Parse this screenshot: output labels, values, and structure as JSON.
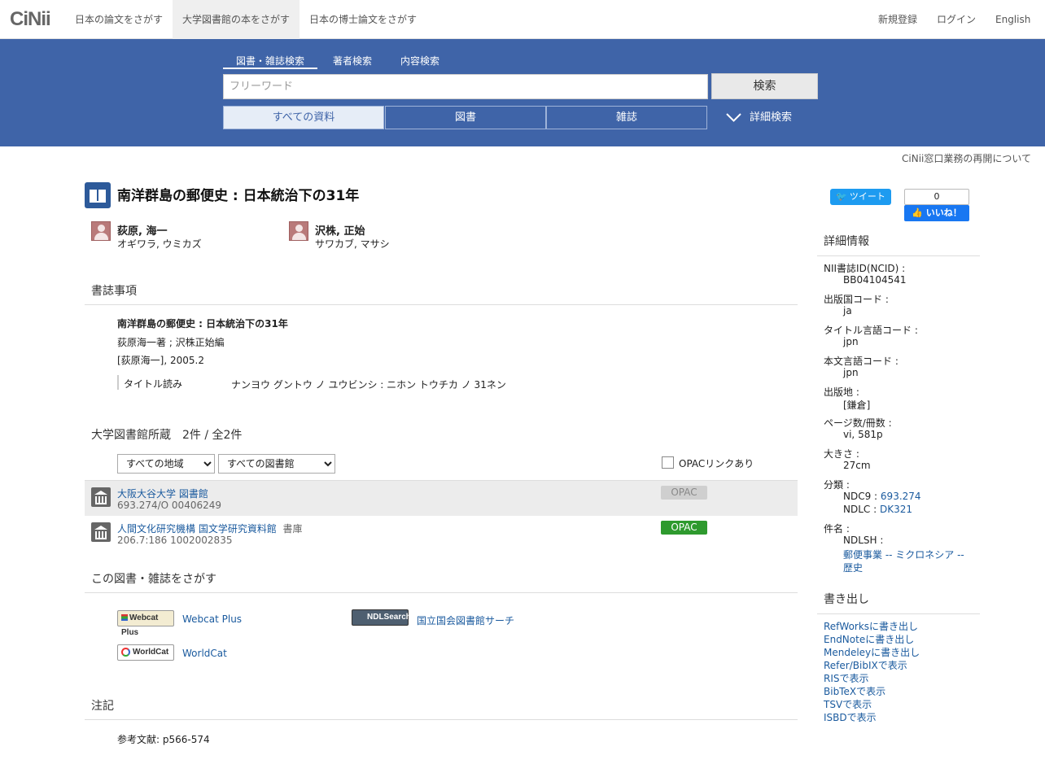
{
  "nav": {
    "logo": "CiNii",
    "tabs": [
      "日本の論文をさがす",
      "大学図書館の本をさがす",
      "日本の博士論文をさがす"
    ],
    "register": "新規登録",
    "login": "ログイン",
    "language": "English"
  },
  "search": {
    "tabs": [
      "図書・雑誌検索",
      "著者検索",
      "内容検索"
    ],
    "placeholder": "フリーワード",
    "button": "検索",
    "scopes": [
      "すべての資料",
      "図書",
      "雑誌"
    ],
    "advanced": "詳細検索"
  },
  "notice": "CiNii窓口業務の再開について",
  "book": {
    "title": "南洋群島の郵便史 : 日本統治下の31年",
    "authors": [
      {
        "name": "荻原, 海一",
        "kana": "オギワラ, ウミカズ"
      },
      {
        "name": "沢株, 正始",
        "kana": "サワカブ, マサシ"
      }
    ]
  },
  "bib": {
    "heading": "書誌事項",
    "title": "南洋群島の郵便史 : 日本統治下の31年",
    "responsibility": "荻原海一著 ; 沢株正始編",
    "publication": "[荻原海一], 2005.2",
    "reading_label": "タイトル読み",
    "reading_value": "ナンヨウ グントウ ノ ユウビンシ : ニホン トウチカ ノ 31ネン"
  },
  "holdings": {
    "heading": "大学図書館所蔵　2件 / 全2件",
    "region_select": "すべての地域",
    "library_select": "すべての図書館",
    "opac_checkbox": "OPACリンクあり",
    "libraries": [
      {
        "name": "大阪大谷大学 図書館",
        "location": "",
        "callno": "693.274/O  00406249",
        "opac": "OPAC"
      },
      {
        "name": "人間文化研究機構 国文学研究資料館",
        "location": "書庫",
        "callno": "206.7:186  1002002835",
        "opac": "OPAC"
      }
    ]
  },
  "find": {
    "heading": "この図書・雑誌をさがす",
    "links": [
      {
        "logo": "Webcat Plus",
        "label": "Webcat Plus"
      },
      {
        "logo": "NDLSearch",
        "label": "国立国会図書館サーチ"
      },
      {
        "logo": "WorldCat",
        "label": "WorldCat"
      }
    ]
  },
  "notes": {
    "heading": "注記",
    "text": "参考文献: p566-574"
  },
  "social": {
    "tweet": "ツイート",
    "like_count": "0",
    "like": "いいね！"
  },
  "details": {
    "heading": "詳細情報",
    "ncid_label": "NII書誌ID(NCID) :",
    "ncid": "BB04104541",
    "country_label": "出版国コード :",
    "country": "ja",
    "title_lang_label": "タイトル言語コード :",
    "title_lang": "jpn",
    "text_lang_label": "本文言語コード :",
    "text_lang": "jpn",
    "place_label": "出版地 :",
    "place": "[鎌倉]",
    "pages_label": "ページ数/冊数 :",
    "pages": "vi, 581p",
    "size_label": "大きさ :",
    "size": "27cm",
    "class_label": "分類 :",
    "ndc9_label": "NDC9 :",
    "ndc9": "693.274",
    "ndlc_label": "NDLC :",
    "ndlc": "DK321",
    "subject_label": "件名 :",
    "ndlsh_label": "NDLSH :",
    "subject_line1": "郵便事業 -- ミクロネシア --",
    "subject_line2": "歴史"
  },
  "export": {
    "heading": "書き出し",
    "links": [
      "RefWorksに書き出し",
      "EndNoteに書き出し",
      "Mendeleyに書き出し",
      "Refer/BibIXで表示",
      "RISで表示",
      "BibTeXで表示",
      "TSVで表示",
      "ISBDで表示"
    ]
  }
}
